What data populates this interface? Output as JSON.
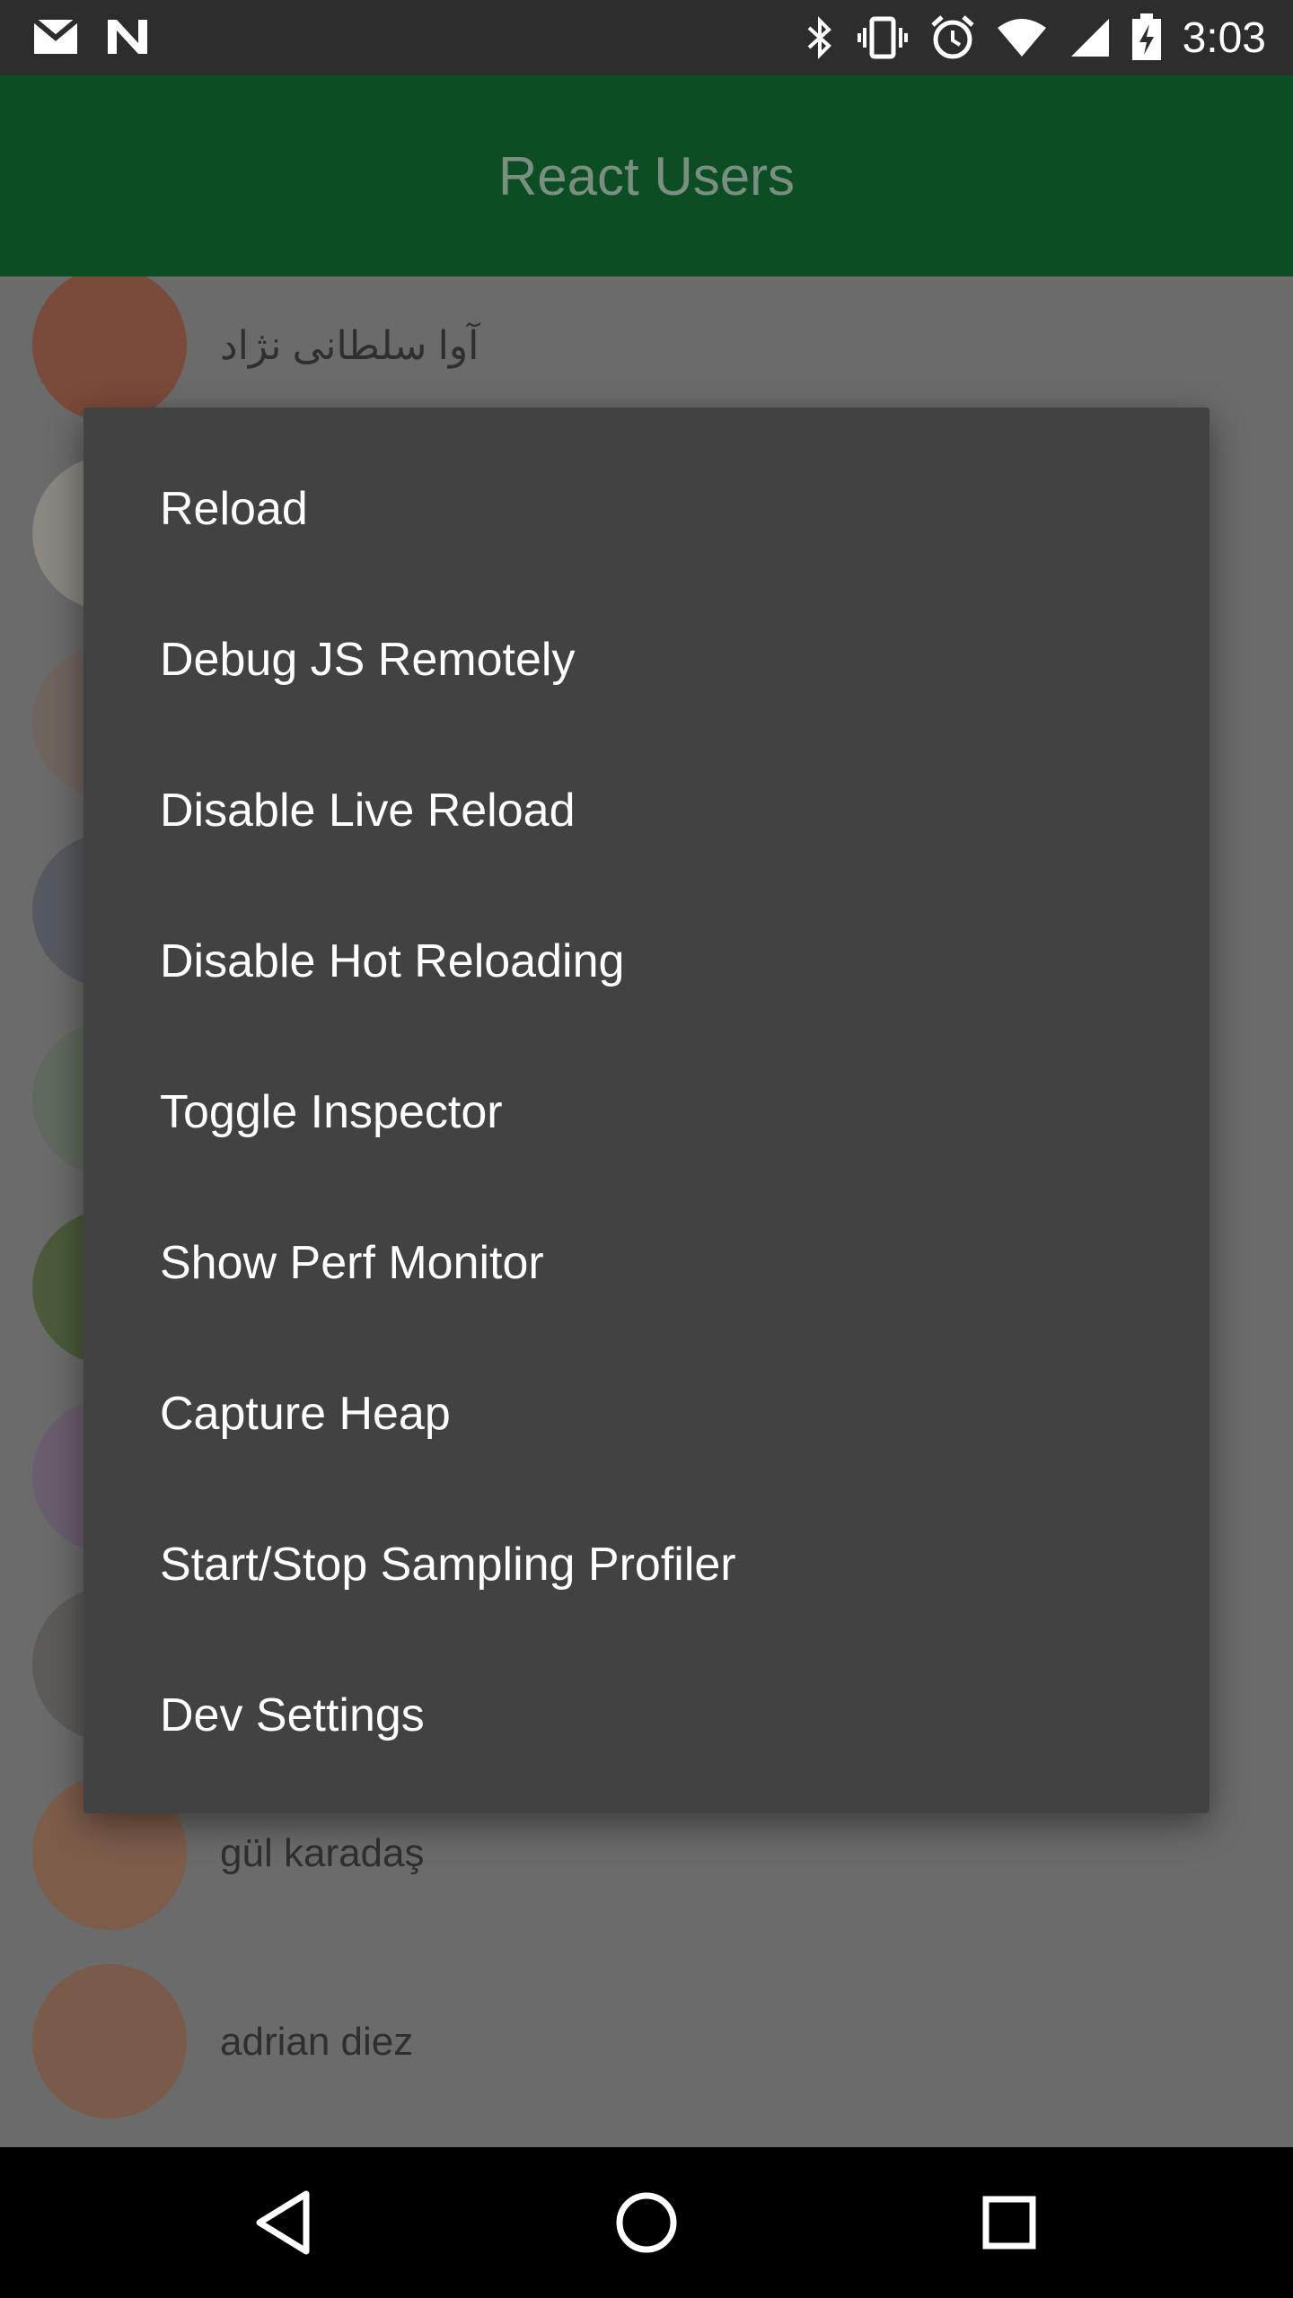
{
  "status_bar": {
    "time": "3:03",
    "left_icons": [
      "gmail-icon",
      "notification-n-icon"
    ],
    "right_icons": [
      "bluetooth-icon",
      "vibrate-icon",
      "alarm-icon",
      "wifi-icon",
      "signal-icon",
      "battery-charging-icon"
    ]
  },
  "app_bar": {
    "title": "React Users",
    "color": "#0d4d24"
  },
  "users": [
    {
      "name": "آوا سلطانی نژاد",
      "avatar_color": "#7a4a3a"
    },
    {
      "name": "",
      "avatar_color": "#8a8680"
    },
    {
      "name": "",
      "avatar_color": "#6f655e"
    },
    {
      "name": "",
      "avatar_color": "#555a60"
    },
    {
      "name": "",
      "avatar_color": "#5f6a5c"
    },
    {
      "name": "",
      "avatar_color": "#4a5a3a"
    },
    {
      "name": "",
      "avatar_color": "#6a5e6e"
    },
    {
      "name": "",
      "avatar_color": "#5e5a58"
    },
    {
      "name": "gül karadaş",
      "avatar_color": "#7d5c4a"
    },
    {
      "name": "adrian diez",
      "avatar_color": "#7a5a48"
    }
  ],
  "dev_menu": {
    "items": [
      {
        "label": "Reload"
      },
      {
        "label": "Debug JS Remotely"
      },
      {
        "label": "Disable Live Reload"
      },
      {
        "label": "Disable Hot Reloading"
      },
      {
        "label": "Toggle Inspector"
      },
      {
        "label": "Show Perf Monitor"
      },
      {
        "label": "Capture Heap"
      },
      {
        "label": "Start/Stop Sampling Profiler"
      },
      {
        "label": "Dev Settings"
      }
    ]
  },
  "nav_bar": {
    "buttons": [
      "back-icon",
      "home-icon",
      "recents-icon"
    ]
  }
}
